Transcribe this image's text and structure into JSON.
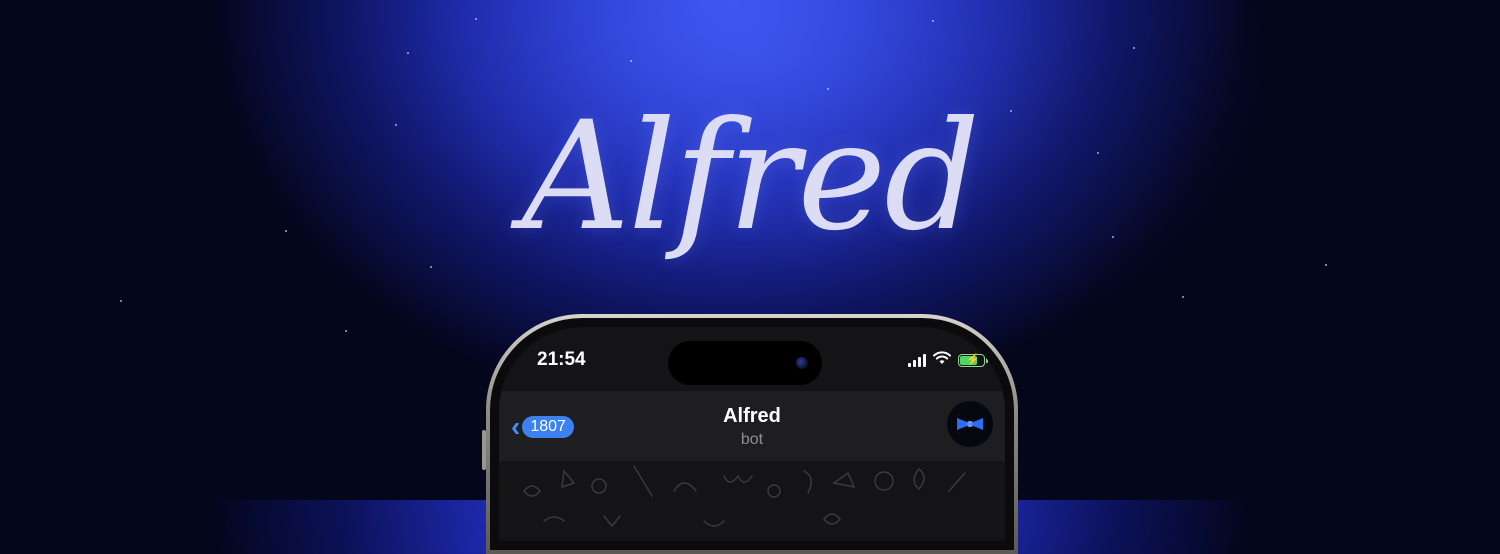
{
  "banner": {
    "title": "Alfred"
  },
  "phone": {
    "status_bar": {
      "time": "21:54",
      "icons": [
        "cellular-signal-icon",
        "wifi-icon",
        "battery-charging-icon"
      ]
    },
    "chat_header": {
      "back_badge": "1807",
      "title": "Alfred",
      "subtitle": "bot",
      "avatar_icon": "bow-tie-icon"
    }
  },
  "colors": {
    "background_dark": "#04061c",
    "glow_blue": "#3b52f0",
    "accent_blue": "#3b82f0",
    "battery_green": "#4cd964"
  }
}
